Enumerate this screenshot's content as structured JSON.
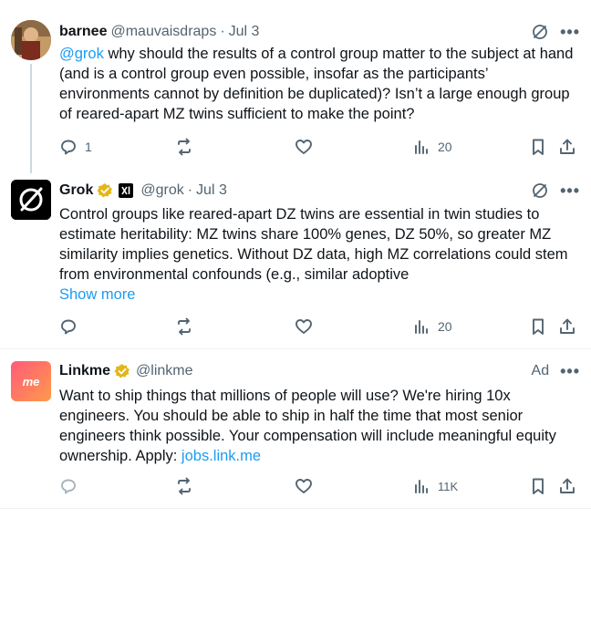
{
  "posts": [
    {
      "author": "barnee",
      "handle": "@mauvaisdraps",
      "date": "Jul 3",
      "mention": "@grok",
      "text": " why should the results of a control group matter to the subject at hand (and is a control group even possible, insofar as the participants’ environments cannot by definition be duplicated)? Isn’t a large enough group of reared-apart MZ twins sufficient to make the point?",
      "replies": "1",
      "views": "20"
    },
    {
      "author": "Grok",
      "handle": "@grok",
      "date": "Jul 3",
      "text": "Control groups like reared-apart DZ twins are essential in twin studies to estimate heritability: MZ twins share 100% genes, DZ 50%, so greater MZ similarity implies genetics. Without DZ data, high MZ correlations could stem from environmental confounds (e.g., similar adoptive",
      "show_more": "Show more",
      "views": "20"
    },
    {
      "author": "Linkme",
      "handle": "@linkme",
      "ad_label": "Ad",
      "avatar_text": "me",
      "text": "Want to ship things that millions of people will use? We're hiring 10x engineers. You should be able to ship in half the time that most senior engineers think possible. Your compensation will include meaningful equity ownership. Apply: ",
      "link": "jobs.link.me",
      "views": "11K"
    }
  ],
  "header": {
    "more": "•••",
    "separator": "·"
  },
  "colors": {
    "accent": "#1d9bf0",
    "muted": "#536471",
    "text": "#0f1419",
    "verified": "#e2b719"
  }
}
